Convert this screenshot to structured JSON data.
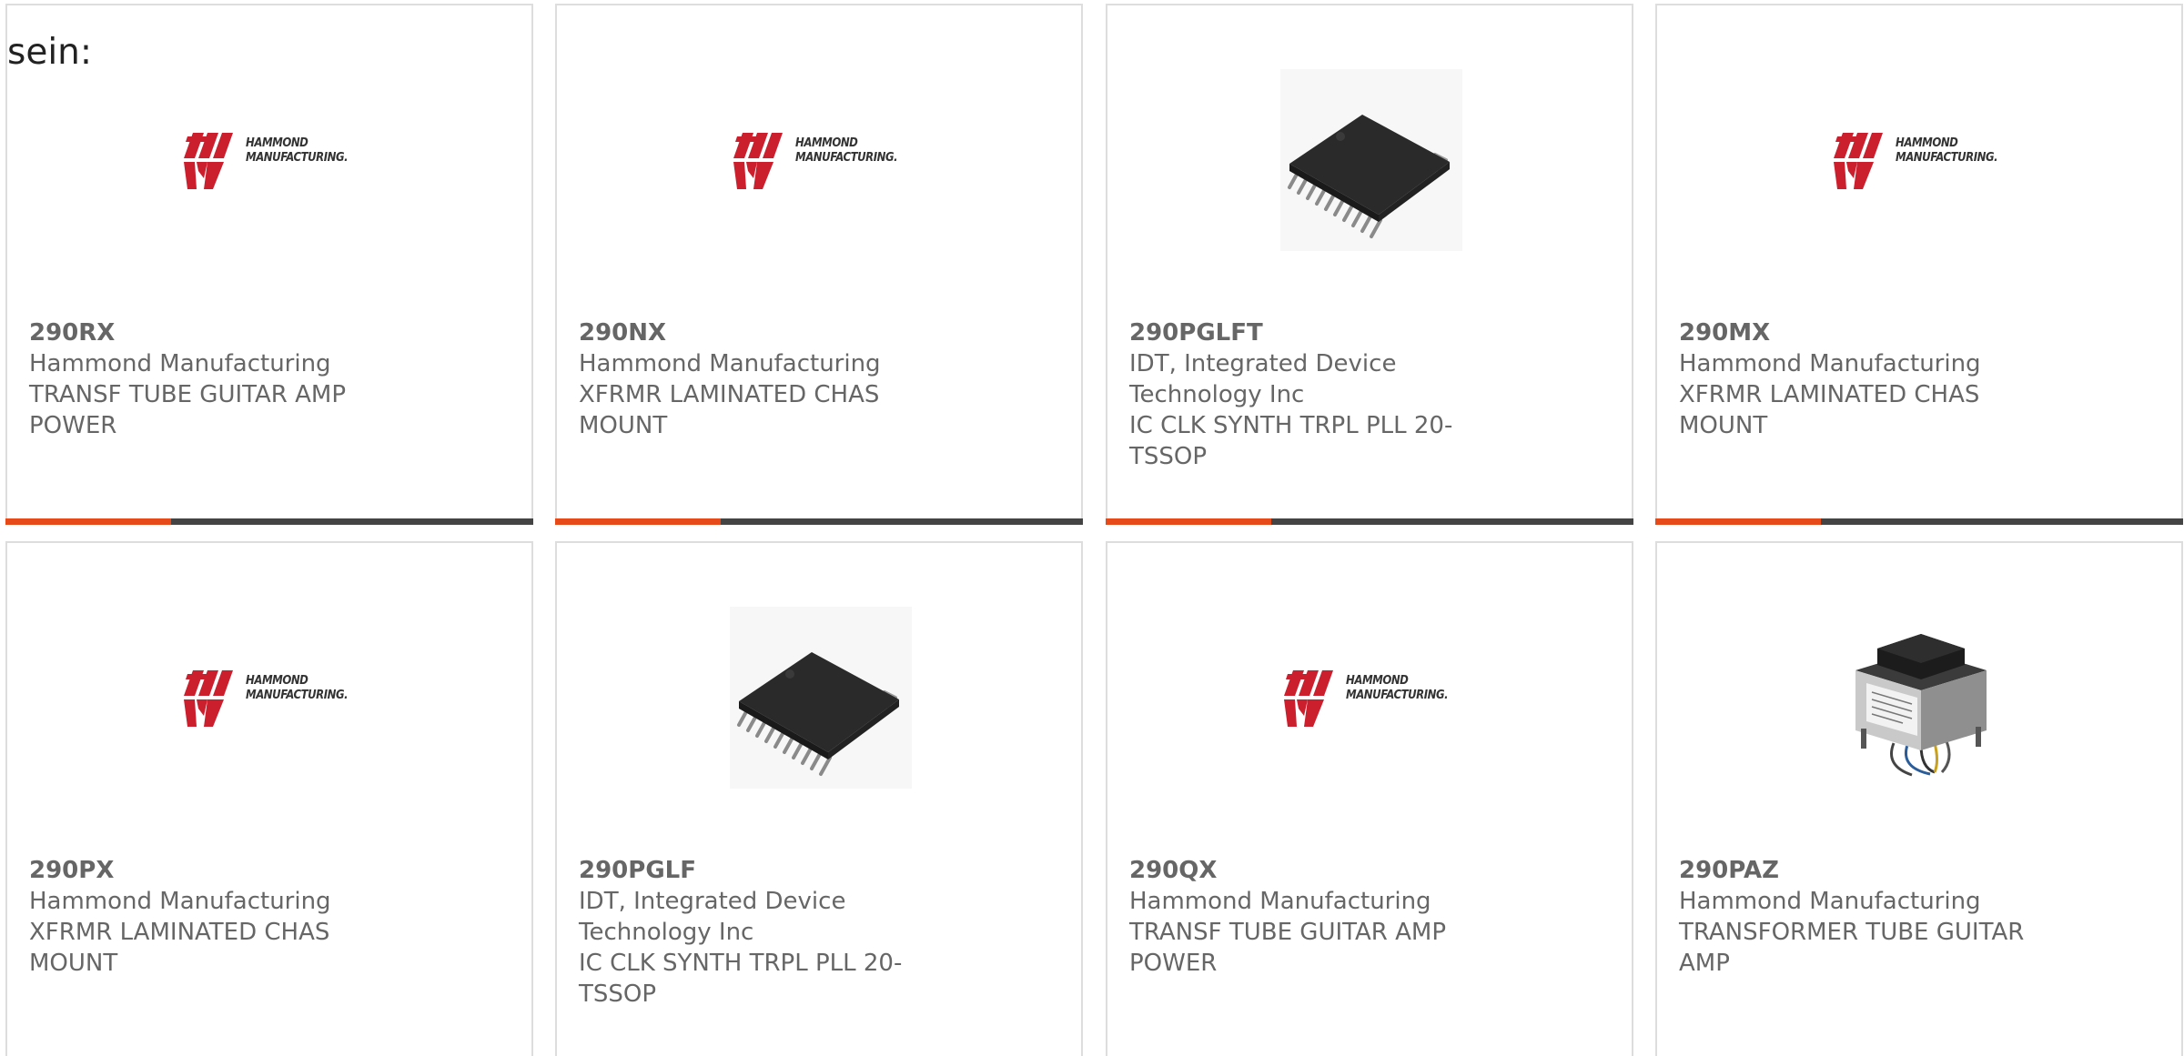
{
  "heading": "sein:",
  "colors": {
    "accent": "#e64a19",
    "bar": "#444444",
    "hammond_red": "#cc1f2e",
    "text": "#666666"
  },
  "products": [
    {
      "part": "290RX",
      "maker": "Hammond Manufacturing",
      "desc": "TRANSF TUBE GUITAR AMP POWER",
      "image": "hammond-logo"
    },
    {
      "part": "290NX",
      "maker": "Hammond Manufacturing",
      "desc": "XFRMR LAMINATED CHAS MOUNT",
      "image": "hammond-logo"
    },
    {
      "part": "290PGLFT",
      "maker": "IDT, Integrated Device Technology Inc",
      "desc": "IC CLK SYNTH TRPL PLL 20-TSSOP",
      "image": "chip-tssop"
    },
    {
      "part": "290MX",
      "maker": "Hammond Manufacturing",
      "desc": "XFRMR LAMINATED CHAS MOUNT",
      "image": "hammond-logo"
    },
    {
      "part": "290PX",
      "maker": "Hammond Manufacturing",
      "desc": "XFRMR LAMINATED CHAS MOUNT",
      "image": "hammond-logo"
    },
    {
      "part": "290PGLF",
      "maker": "IDT, Integrated Device Technology Inc",
      "desc": "IC CLK SYNTH TRPL PLL 20-TSSOP",
      "image": "chip-tssop"
    },
    {
      "part": "290QX",
      "maker": "Hammond Manufacturing",
      "desc": "TRANSF TUBE GUITAR AMP POWER",
      "image": "hammond-logo"
    },
    {
      "part": "290PAZ",
      "maker": "Hammond Manufacturing",
      "desc": "TRANSFORMER TUBE GUITAR AMP",
      "image": "transformer"
    }
  ],
  "logo_text": {
    "line1": "HAMMOND",
    "line2": "MANUFACTURING."
  }
}
